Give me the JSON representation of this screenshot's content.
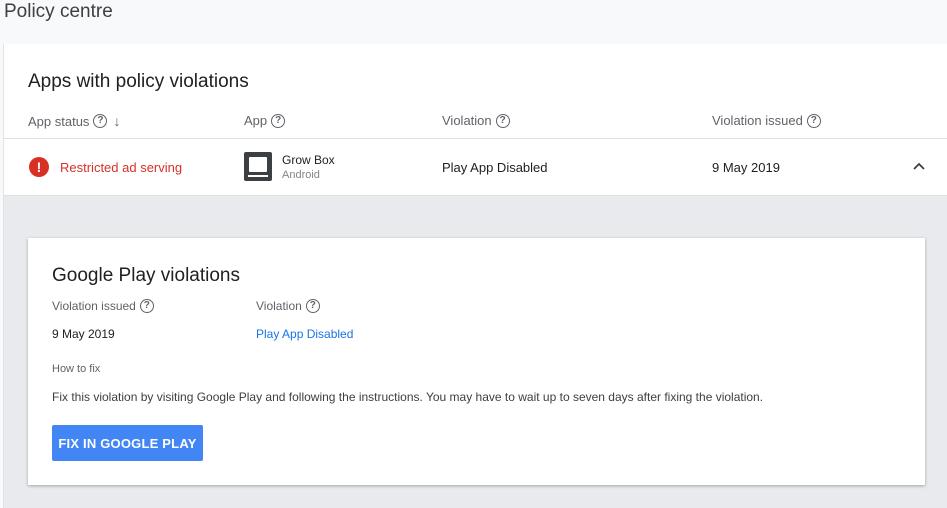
{
  "page": {
    "title": "Policy centre"
  },
  "table": {
    "title": "Apps with policy violations",
    "columns": {
      "app_status": "App status",
      "app": "App",
      "violation": "Violation",
      "violation_issued": "Violation issued"
    },
    "row": {
      "status": "Restricted ad serving",
      "app_name": "Grow Box",
      "app_platform": "Android",
      "violation": "Play App Disabled",
      "issued": "9 May 2019"
    }
  },
  "details": {
    "title": "Google Play violations",
    "violation_issued_label": "Violation issued",
    "violation_label": "Violation",
    "issued_value": "9 May 2019",
    "violation_link": "Play App Disabled",
    "how_to_fix_label": "How to fix",
    "how_to_fix_text": "Fix this violation by visiting Google Play and following the instructions. You may have to wait up to seven days after fixing the violation.",
    "button_label": "FIX IN GOOGLE PLAY"
  },
  "icons": {
    "help": "help-circle-icon",
    "sort": "arrow-down-icon",
    "error": "error-icon",
    "app": "app-icon",
    "collapse": "chevron-up-icon"
  },
  "colors": {
    "accent": "#4285f4",
    "error": "#d93025",
    "link": "#1a73e8"
  }
}
